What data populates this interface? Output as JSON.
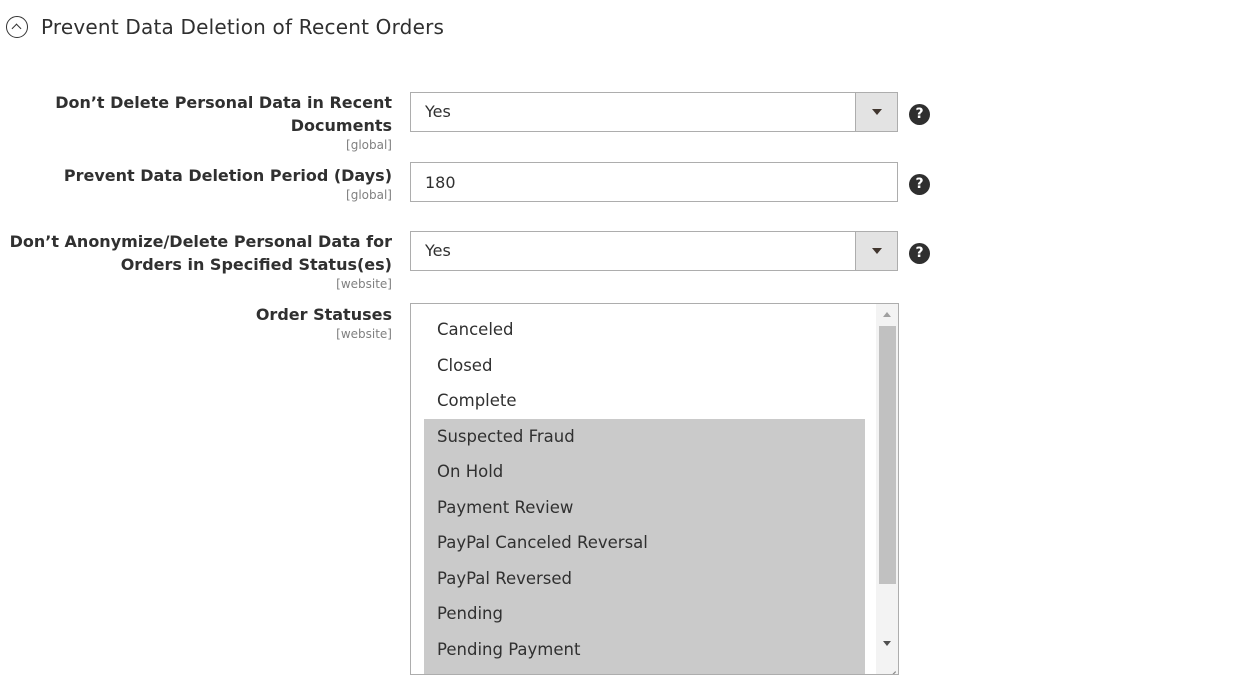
{
  "section": {
    "title": "Prevent Data Deletion of Recent Orders",
    "icon": "collapse-up-icon"
  },
  "fields": {
    "dont_delete_recent": {
      "label_line1": "Don’t Delete Personal Data in Recent",
      "label_line2": "Documents",
      "scope": "[global]",
      "value": "Yes"
    },
    "period_days": {
      "label": "Prevent Data Deletion Period (Days)",
      "scope": "[global]",
      "value": "180"
    },
    "dont_anonymize": {
      "label_line1": "Don’t Anonymize/Delete Personal Data for",
      "label_line2": "Orders in Specified Status(es)",
      "scope": "[website]",
      "value": "Yes"
    },
    "order_statuses": {
      "label": "Order Statuses",
      "scope": "[website]",
      "options": [
        {
          "label": "Canceled",
          "selected": false
        },
        {
          "label": "Closed",
          "selected": false
        },
        {
          "label": "Complete",
          "selected": false
        },
        {
          "label": "Suspected Fraud",
          "selected": true
        },
        {
          "label": "On Hold",
          "selected": true
        },
        {
          "label": "Payment Review",
          "selected": true
        },
        {
          "label": "PayPal Canceled Reversal",
          "selected": true
        },
        {
          "label": "PayPal Reversed",
          "selected": true
        },
        {
          "label": "Pending",
          "selected": true
        },
        {
          "label": "Pending Payment",
          "selected": true
        },
        {
          "label": "",
          "selected": true
        }
      ]
    }
  },
  "help_icon": "?",
  "colors": {
    "selected_bg": "#cacaca",
    "text": "#303030",
    "scope": "#808080",
    "border": "#adadad"
  }
}
